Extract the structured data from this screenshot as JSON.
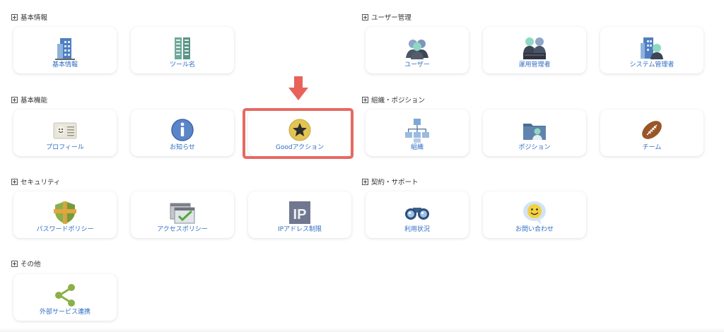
{
  "sections": {
    "basic_info": "基本情報",
    "basic_functions": "基本機能",
    "security": "セキュリティ",
    "other": "その他",
    "user_management": "ユーザー管理",
    "org_position": "組織・ポジション",
    "contract_support": "契約・サポート"
  },
  "cards": {
    "basic_info": "基本情報",
    "tool_name": "ツール名",
    "profile": "プロフィール",
    "notice": "お知らせ",
    "good_action": "Goodアクション",
    "password_policy": "パスワードポリシー",
    "access_policy": "アクセスポリシー",
    "ip_restriction": "IPアドレス制限",
    "external_service": "外部サービス連携",
    "user": "ユーザー",
    "ops_admin": "運用管理者",
    "sys_admin": "システム管理者",
    "org": "組織",
    "position": "ポジション",
    "team": "チーム",
    "usage": "利用状況",
    "contact": "お問い合わせ"
  },
  "icon_glyphs": {
    "ip": "IP"
  },
  "colors": {
    "link_blue": "#2f6dc5",
    "highlight_red": "#e56a62",
    "arrow_red": "#e8625a"
  },
  "icons": {
    "basic_info": "building-icon",
    "tool_name": "green-building-icon",
    "profile": "id-card-icon",
    "notice": "info-icon",
    "good_action": "star-icon",
    "password_policy": "shield-icon",
    "access_policy": "window-check-icon",
    "ip_restriction": "ip-icon",
    "external_service": "share-icon",
    "user": "users-icon",
    "ops_admin": "admins-icon",
    "sys_admin": "building-user-icon",
    "org": "org-chart-icon",
    "position": "folder-user-icon",
    "team": "football-icon",
    "usage": "binoculars-icon",
    "contact": "chat-smile-icon"
  }
}
